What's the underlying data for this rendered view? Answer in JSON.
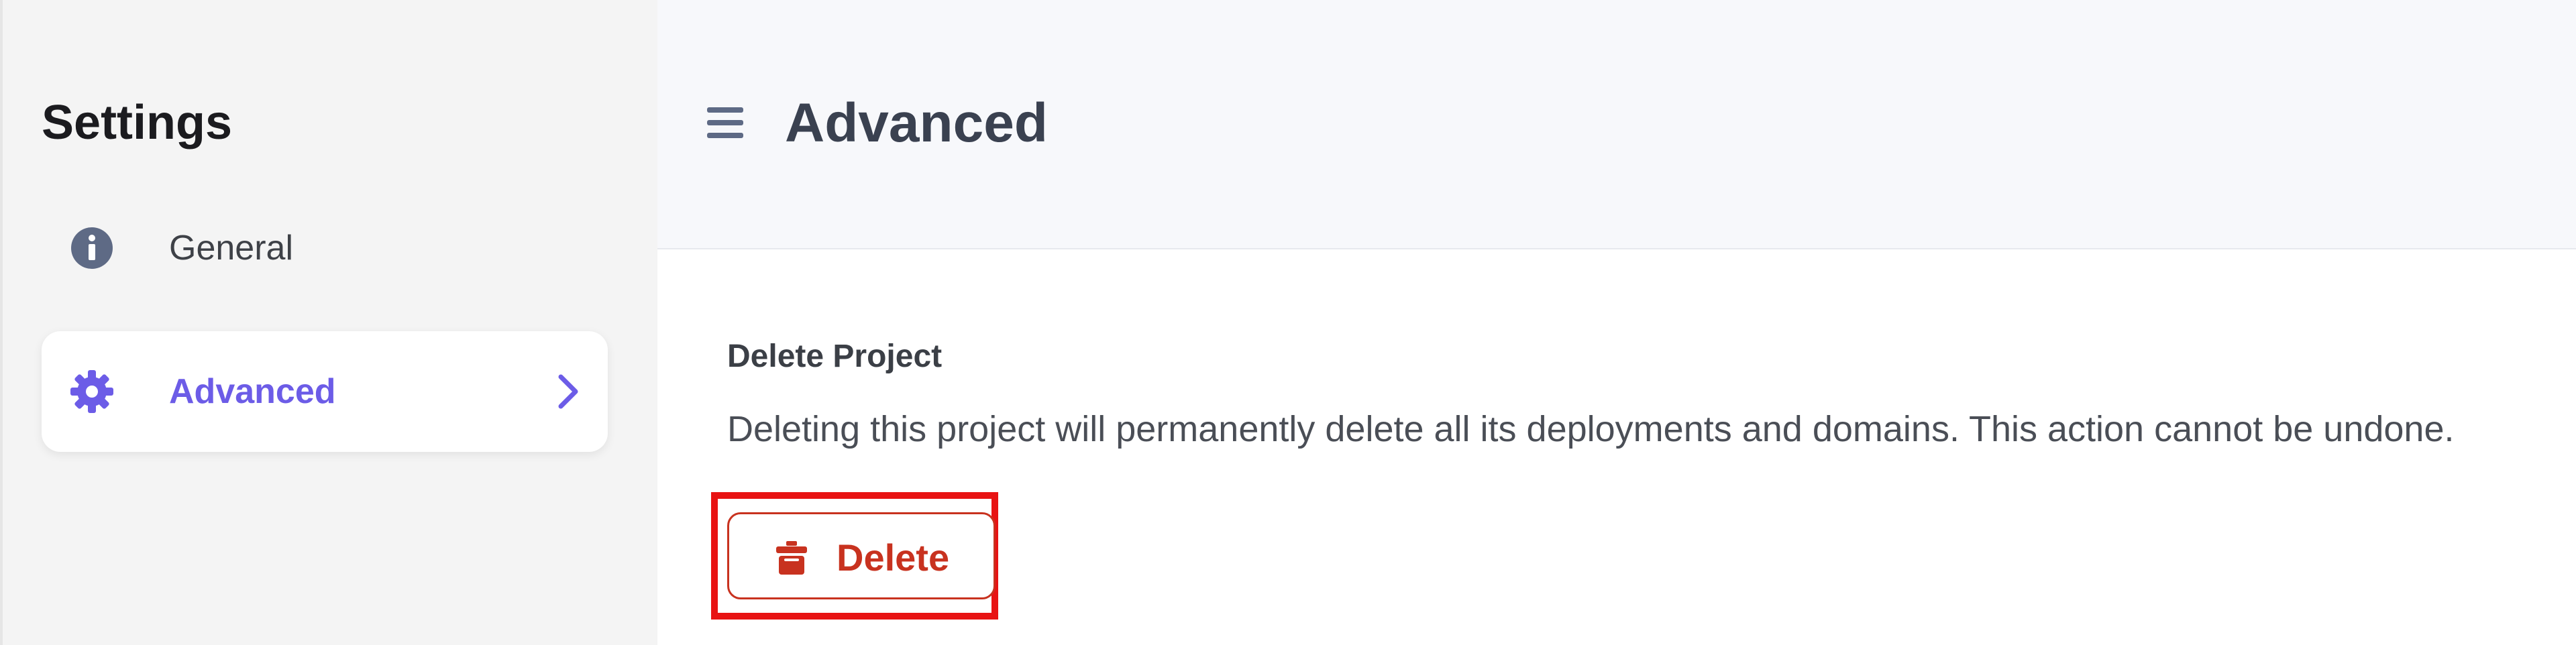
{
  "sidebar": {
    "title": "Settings",
    "items": [
      {
        "label": "General",
        "icon": "info-circle-icon",
        "active": false
      },
      {
        "label": "Advanced",
        "icon": "gear-icon",
        "active": true
      }
    ]
  },
  "header": {
    "title": "Advanced",
    "menu_icon": "menu-icon"
  },
  "section": {
    "title": "Delete Project",
    "description": "Deleting this project will permanently delete all its deployments and domains. This action cannot be undone.",
    "delete_label": "Delete",
    "delete_icon": "trash-icon"
  },
  "colors": {
    "accent": "#6c5ce7",
    "danger": "#c8321f",
    "highlight": "#e81313",
    "icon_gray": "#5e6a85"
  }
}
